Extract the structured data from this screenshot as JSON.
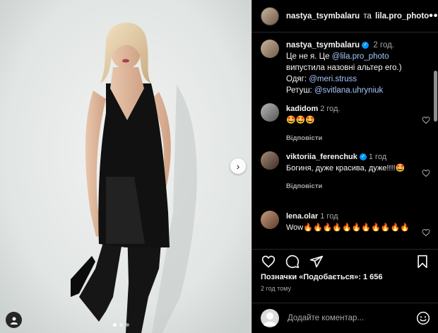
{
  "header": {
    "author": "nastya_tsymbalaru",
    "joiner": "та",
    "collaborator": "lila.pro_photo"
  },
  "caption": {
    "user": "nastya_tsymbalaru",
    "time": "2 год.",
    "text_1": "Це не я. Це ",
    "mention_1": "@lila.pro_photo",
    "text_2": " випустила назовні альтер его.)",
    "text_3": "",
    "outfit_label": "Одяг: ",
    "outfit_mention": "@meri.struss",
    "retouch_label": "Ретуш: ",
    "retouch_mention": "@svitlana.uhryniuk"
  },
  "comments": [
    {
      "user": "kadidom",
      "time": "2 год.",
      "text": "🤩🤩🤩",
      "reply": "Відповісти",
      "verified": false
    },
    {
      "user": "viktoriia_ferenchuk",
      "time": "1 год",
      "text": "Богиня, дуже красива, дуже!!!!🤩",
      "reply": "Відповісти",
      "verified": true
    },
    {
      "user": "lena.olar",
      "time": "1 год",
      "text": "Wow🔥🔥🔥🔥🔥🔥🔥🔥🔥🔥🔥",
      "reply": "",
      "verified": false
    }
  ],
  "likes": "Позначки «Подобається»: 1 656",
  "posted_ago": "2 год тому",
  "composer": {
    "placeholder": "Додайте коментар..."
  },
  "carousel": {
    "total_slides": 3,
    "active_slide": 1
  },
  "icons": {
    "like": "heart-icon",
    "comment": "comment-icon",
    "share": "paper-plane-icon",
    "save": "bookmark-icon",
    "emoji": "emoji-icon",
    "more": "more-icon",
    "next": "chevron-right-icon",
    "tag": "user-tag-icon"
  },
  "colors": {
    "background": "#000000",
    "verified": "#0095f6",
    "link": "#a8c7fa",
    "muted": "#a8a8a8"
  }
}
